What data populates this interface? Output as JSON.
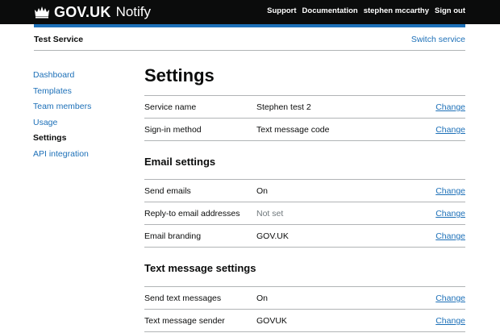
{
  "header": {
    "brand": "GOV.UK",
    "app_name": "Notify",
    "nav": [
      "Support",
      "Documentation",
      "stephen mccarthy",
      "Sign out"
    ]
  },
  "service_bar": {
    "service_name": "Test Service",
    "switch_label": "Switch service"
  },
  "sidebar": {
    "items": [
      {
        "label": "Dashboard",
        "active": false
      },
      {
        "label": "Templates",
        "active": false
      },
      {
        "label": "Team members",
        "active": false
      },
      {
        "label": "Usage",
        "active": false
      },
      {
        "label": "Settings",
        "active": true
      },
      {
        "label": "API integration",
        "active": false
      }
    ]
  },
  "main": {
    "title": "Settings",
    "general_rows": [
      {
        "key": "Service name",
        "value": "Stephen test 2",
        "action": "Change"
      },
      {
        "key": "Sign-in method",
        "value": "Text message code",
        "action": "Change"
      }
    ],
    "email_heading": "Email settings",
    "email_rows": [
      {
        "key": "Send emails",
        "value": "On",
        "action": "Change"
      },
      {
        "key": "Reply-to email addresses",
        "value": "Not set",
        "action": "Change"
      },
      {
        "key": "Email branding",
        "value": "GOV.UK",
        "action": "Change"
      }
    ],
    "sms_heading": "Text message settings",
    "sms_rows": [
      {
        "key": "Send text messages",
        "value": "On",
        "action": "Change"
      },
      {
        "key": "Text message sender",
        "value": "GOVUK",
        "action": "Change"
      }
    ]
  },
  "colors": {
    "header_bg": "#0b0c0c",
    "accent_blue": "#1d70b8",
    "border": "#b1b4b6",
    "muted_text": "#6f777b"
  }
}
